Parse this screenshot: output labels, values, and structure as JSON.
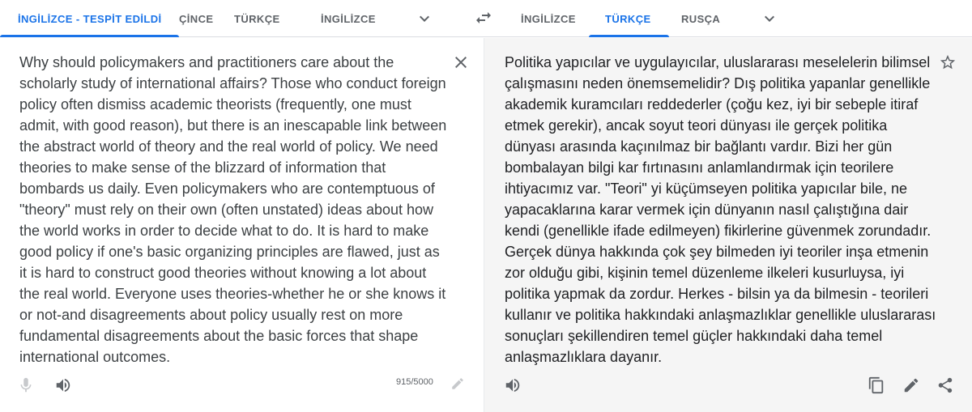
{
  "source_tabs": [
    "İNGİLİZCE - TESPİT EDİLDİ",
    "ÇİNCE",
    "TÜRKÇE",
    "İNGİLİZCE"
  ],
  "target_tabs": [
    "İNGİLİZCE",
    "TÜRKÇE",
    "RUSÇA"
  ],
  "source_active_index": 0,
  "target_active_index": 1,
  "source_text": "Why should policymakers and practitioners care about the scholarly study of international affairs? Those who conduct foreign policy often dismiss academic theorists (frequently, one must admit, with good reason), but there is an inescapable link between the abstract world of theory and the real world of policy. We need theories to make sense of the blizzard of information that bombards us daily. Even policymakers who are contemptuous of \"theory\" must rely on their own (often unstated) ideas about how the world works in order to decide what to do. It is hard to make good policy if one's basic organizing principles are flawed, just as it is hard to construct good theories without knowing a lot about the real world. Everyone uses theories-whether he or she knows it or not-and disagreements about policy usually rest on more fundamental disagreements about the basic forces that shape international outcomes.",
  "translated_text": "Politika yapıcılar ve uygulayıcılar, uluslararası meselelerin bilimsel çalışmasını neden önemsemelidir? Dış politika yapanlar genellikle akademik kuramcıları reddederler (çoğu kez, iyi bir sebeple itiraf etmek gerekir), ancak soyut teori dünyası ile gerçek politika dünyası arasında kaçınılmaz bir bağlantı vardır. Bizi her gün bombalayan bilgi kar fırtınasını anlamlandırmak için teorilere ihtiyacımız var. \"Teori\" yi küçümseyen politika yapıcılar bile, ne yapacaklarına karar vermek için dünyanın nasıl çalıştığına dair kendi (genellikle ifade edilmeyen) fikirlerine güvenmek zorundadır. Gerçek dünya hakkında çok şey bilmeden iyi teoriler inşa etmenin zor olduğu gibi, kişinin temel düzenleme ilkeleri kusurluysa, iyi politika yapmak da zordur. Herkes - bilsin ya da bilmesin - teorileri kullanır ve politika hakkındaki anlaşmazlıklar genellikle uluslararası sonuçları şekillendiren temel güçler hakkındaki daha temel anlaşmazlıklara dayanır.",
  "char_count": "915/5000",
  "icons": {
    "more_languages": "chevron-down-icon",
    "swap": "swap-arrows-icon",
    "clear": "close-icon",
    "star": "star-outline-icon",
    "mic": "microphone-icon",
    "speaker": "speaker-icon",
    "edit": "pencil-icon",
    "copy": "copy-icon",
    "share": "share-icon"
  },
  "colors": {
    "accent": "#1a73e8",
    "target_panel_bg": "#f5f5f5",
    "disabled_icon": "#c7c9cc"
  }
}
